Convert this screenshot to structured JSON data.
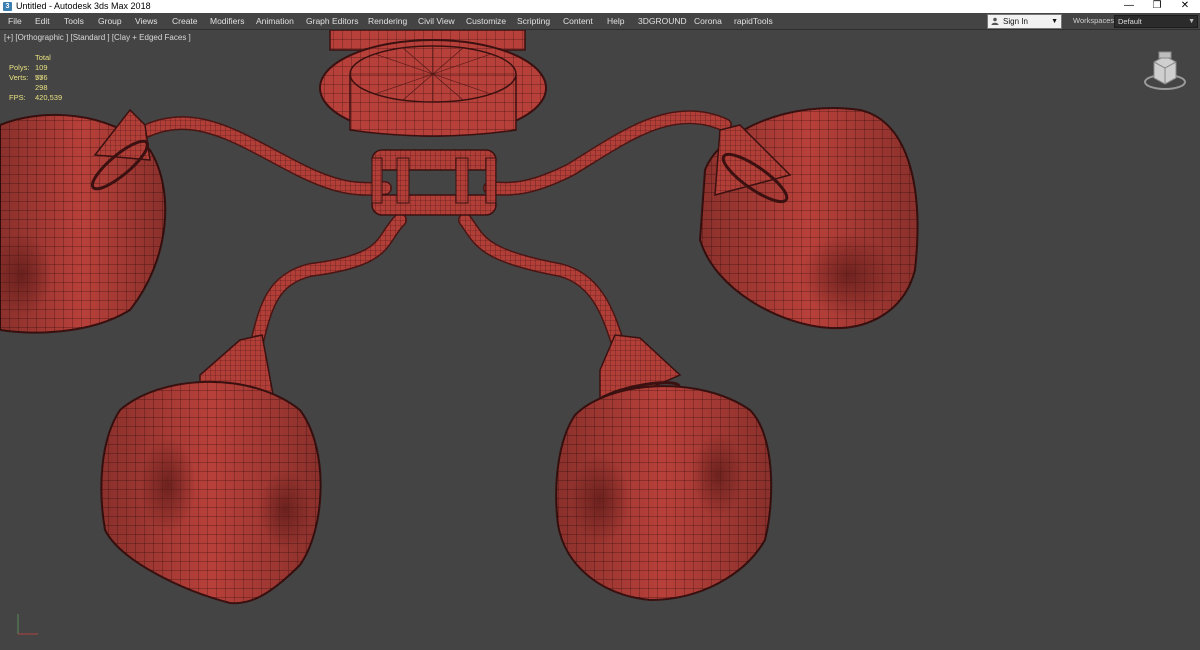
{
  "window": {
    "title": "Untitled - Autodesk 3ds Max 2018",
    "minimize_icon": "minimize-icon",
    "restore_icon": "restore-icon",
    "close_icon": "close-icon"
  },
  "menu": {
    "items": [
      "File",
      "Edit",
      "Tools",
      "Group",
      "Views",
      "Create",
      "Modifiers",
      "Animation",
      "Graph Editors",
      "Rendering",
      "Civil View",
      "Customize",
      "Scripting",
      "Content",
      "Help",
      "3DGROUND",
      "Corona",
      "rapidTools"
    ],
    "sign_in": "Sign In",
    "workspaces_label": "Workspaces:",
    "workspaces_value": "Default"
  },
  "viewport": {
    "label": "[+] [Orthographic ] [Standard ] [Clay + Edged Faces ]",
    "stats": {
      "total_label": "Total",
      "polys_label": "Polys:",
      "polys_value": "109 776",
      "verts_label": "Verts:",
      "verts_value": "55 298",
      "fps_label": "FPS:",
      "fps_value": "420,539"
    },
    "model_color": "#b8403a",
    "wire_color": "#4a1614",
    "background": "#444444"
  }
}
